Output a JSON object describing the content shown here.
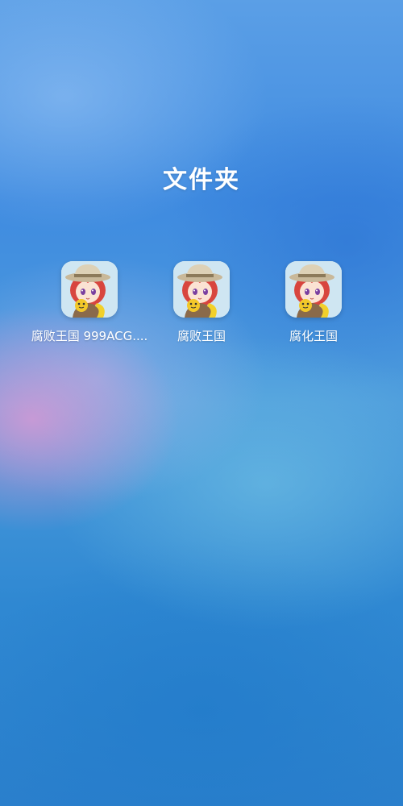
{
  "folder": {
    "title": "文件夹"
  },
  "apps": [
    {
      "label": "腐败王国 999ACG....",
      "icon": "anime-girl-app-icon"
    },
    {
      "label": "腐败王国",
      "icon": "anime-girl-app-icon"
    },
    {
      "label": "腐化王国",
      "icon": "anime-girl-app-icon"
    }
  ],
  "colors": {
    "wallpaper_primary": "#3f8be0",
    "wallpaper_accent_pink": "#e696d2",
    "text": "#ffffff",
    "icon_background": "#cfe6f2"
  }
}
